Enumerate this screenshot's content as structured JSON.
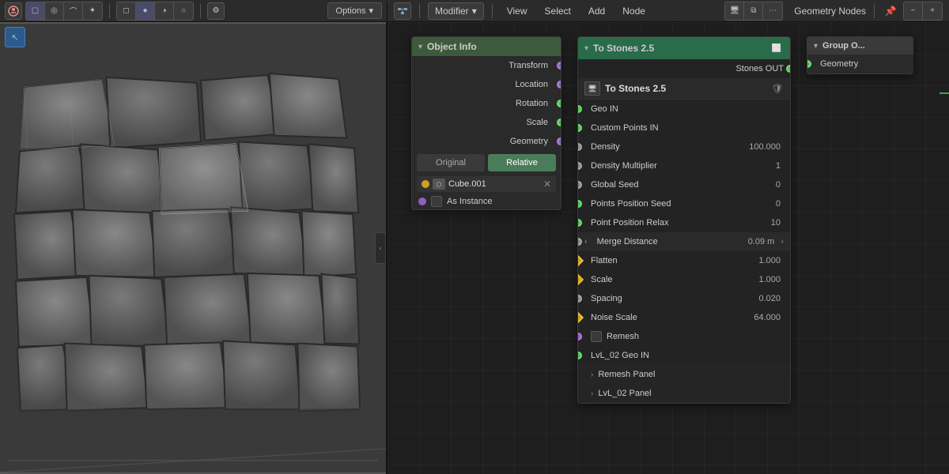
{
  "topbar": {
    "left": {
      "menu_items": [
        "View",
        "Select",
        "Add",
        "Node"
      ],
      "modifier_label": "Modifier",
      "dropdown_arrow": "▾"
    },
    "right": {
      "title": "Geometry Nodes",
      "pin_label": "📌"
    }
  },
  "viewport": {
    "options_label": "Options",
    "dropdown_arrow": "▾"
  },
  "object_info_node": {
    "title": "Object Info",
    "rows": [
      {
        "label": "Transform",
        "socket_color": "purple"
      },
      {
        "label": "Location",
        "socket_color": "purple"
      },
      {
        "label": "Rotation",
        "socket_color": "purple"
      },
      {
        "label": "Scale",
        "socket_color": "green"
      },
      {
        "label": "Geometry",
        "socket_color": "purple"
      }
    ],
    "original_btn": "Original",
    "relative_btn": "Relative",
    "object_name": "Cube.001",
    "as_instance_label": "As Instance"
  },
  "to_stones_node": {
    "title": "To Stones 2.5",
    "inner_title": "To Stones 2.5",
    "inputs": [
      {
        "label": "Geo IN",
        "socket_color": "green"
      },
      {
        "label": "Custom Points IN",
        "socket_color": "green"
      }
    ],
    "params": [
      {
        "label": "Density",
        "value": "100.000",
        "socket_color": "gray"
      },
      {
        "label": "Density Multiplier",
        "value": "1",
        "socket_color": "gray"
      },
      {
        "label": "Global Seed",
        "value": "0",
        "socket_color": "gray"
      },
      {
        "label": "Points Position Seed",
        "value": "0",
        "socket_color": "gray"
      },
      {
        "label": "Point Position Relax",
        "value": "10",
        "socket_color": "gray"
      },
      {
        "label": "Flatten",
        "value": "1.000",
        "socket_color": "diamond"
      },
      {
        "label": "Scale",
        "value": "1.000",
        "socket_color": "diamond"
      },
      {
        "label": "Spacing",
        "value": "0.020",
        "socket_color": "gray"
      },
      {
        "label": "Noise Scale",
        "value": "64.000",
        "socket_color": "diamond"
      },
      {
        "label": "Remesh",
        "value": "",
        "socket_color": "gray"
      }
    ],
    "merge_distance": {
      "label": "Merge Distance",
      "value": "0.09 m"
    },
    "outputs": [
      {
        "label": "Stones OUT",
        "socket_color": "green"
      }
    ],
    "lvl02_geo_in": "LvL_02 Geo IN",
    "remesh_panel": "Remesh Panel",
    "lvl02_panel": "LvL_02 Panel"
  },
  "group_output_node": {
    "title": "Group O...",
    "geometry_label": "Geometry"
  }
}
